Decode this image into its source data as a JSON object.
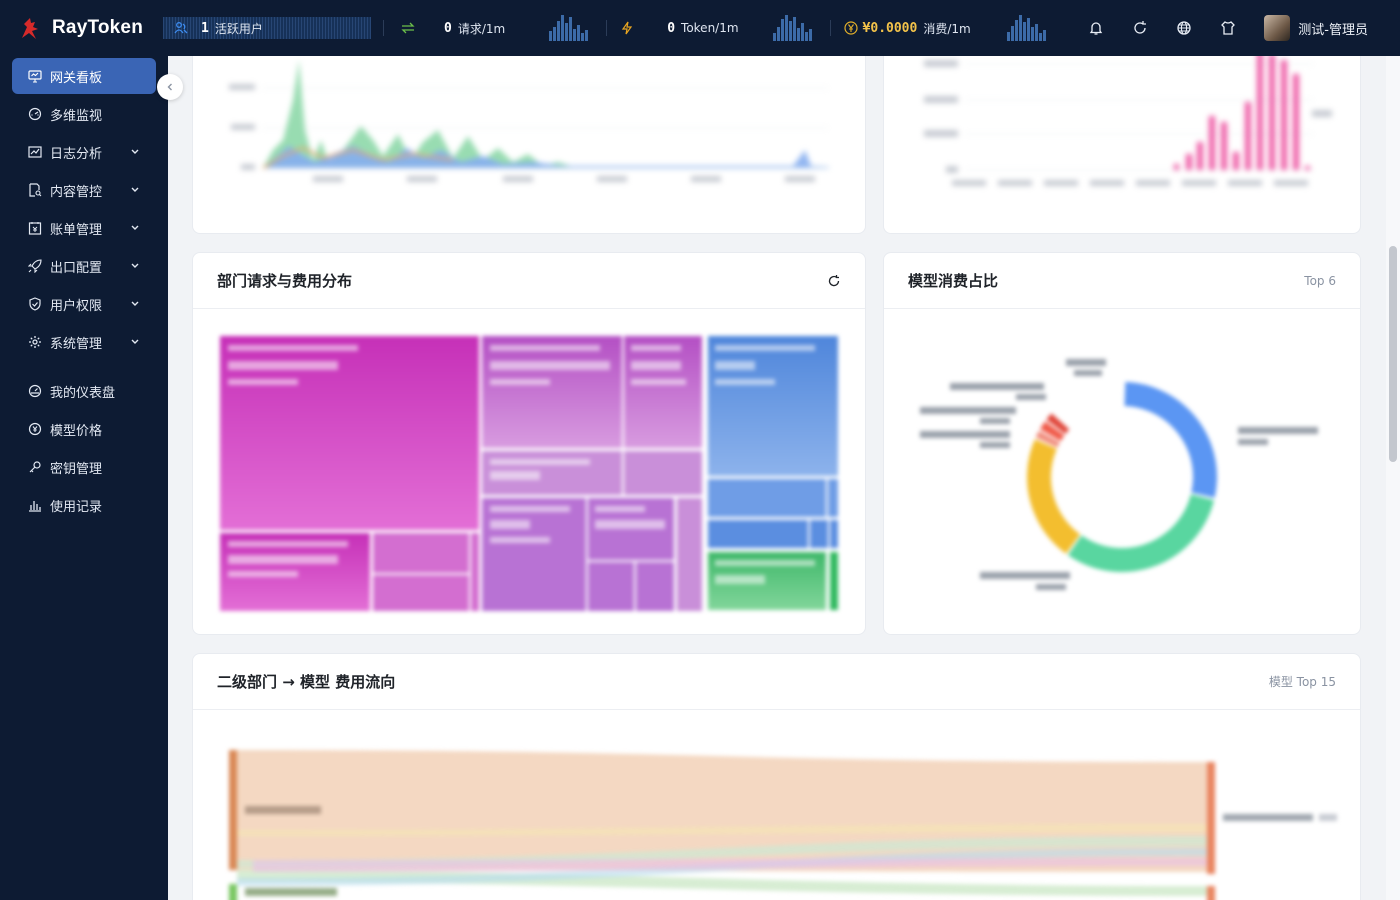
{
  "brand": {
    "name": "RayToken",
    "accent": "#3a65b5",
    "nav_bg": "#0d1b33"
  },
  "topbar": {
    "stats": [
      {
        "value": "1",
        "label": "活跃用户",
        "icon": "users-icon",
        "color": "#3d8cf0"
      },
      {
        "value": "0",
        "label": "请求/1m",
        "icon": "swap-icon",
        "color": "#6cc04a"
      },
      {
        "value": "0",
        "label": "Token/1m",
        "icon": "bolt-icon",
        "color": "#e8a520"
      },
      {
        "value": "¥0.0000",
        "label": "消费/1m",
        "icon": "yen-icon",
        "color": "#e3b02a"
      }
    ],
    "user_name": "测试-管理员",
    "icons": [
      "bell-icon",
      "refresh-icon",
      "globe-icon",
      "shirt-icon"
    ]
  },
  "sidebar": {
    "items": [
      {
        "label": "网关看板",
        "icon": "monitor-icon",
        "active": true,
        "has_children": false
      },
      {
        "label": "多维监视",
        "icon": "gauge-icon",
        "active": false,
        "has_children": false
      },
      {
        "label": "日志分析",
        "icon": "chart-line-icon",
        "active": false,
        "has_children": true
      },
      {
        "label": "内容管控",
        "icon": "document-search-icon",
        "active": false,
        "has_children": true
      },
      {
        "label": "账单管理",
        "icon": "bill-icon",
        "active": false,
        "has_children": true
      },
      {
        "label": "出口配置",
        "icon": "rocket-icon",
        "active": false,
        "has_children": true
      },
      {
        "label": "用户权限",
        "icon": "shield-icon",
        "active": false,
        "has_children": true
      },
      {
        "label": "系统管理",
        "icon": "gear-icon",
        "active": false,
        "has_children": true
      },
      {
        "label": "我的仪表盘",
        "icon": "dashboard-icon",
        "active": false,
        "has_children": false
      },
      {
        "label": "模型价格",
        "icon": "price-icon",
        "active": false,
        "has_children": false
      },
      {
        "label": "密钥管理",
        "icon": "key-icon",
        "active": false,
        "has_children": false
      },
      {
        "label": "使用记录",
        "icon": "bar-chart-icon",
        "active": false,
        "has_children": false
      }
    ]
  },
  "cards": {
    "dept_dist": {
      "title": "部门请求与费用分布"
    },
    "model_share": {
      "title": "模型消费占比",
      "extra": "Top 6"
    },
    "flow": {
      "title": "二级部门 → 模型 费用流向",
      "extra": "模型 Top 15"
    }
  }
}
